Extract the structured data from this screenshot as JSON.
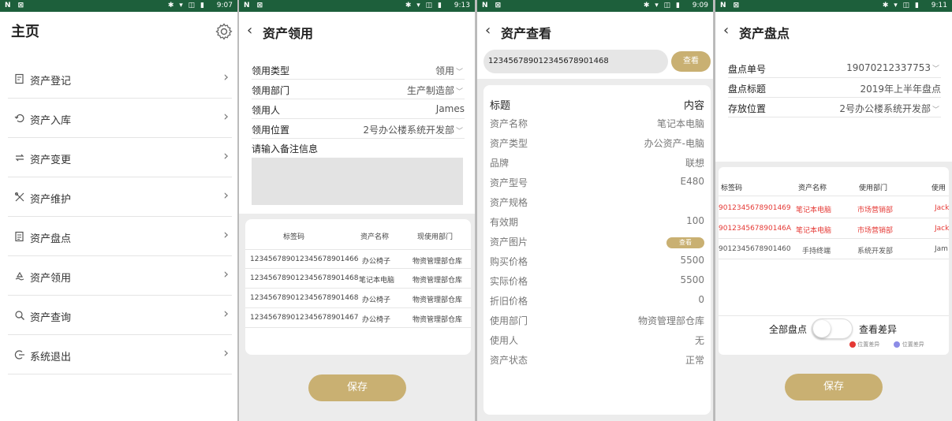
{
  "screens": [
    {
      "time": "9:07",
      "title": "主页",
      "menu": [
        {
          "label": "资产登记",
          "icon": "register-icon"
        },
        {
          "label": "资产入库",
          "icon": "inbound-icon"
        },
        {
          "label": "资产变更",
          "icon": "change-icon"
        },
        {
          "label": "资产维护",
          "icon": "maintain-icon"
        },
        {
          "label": "资产盘点",
          "icon": "inventory-icon"
        },
        {
          "label": "资产领用",
          "icon": "requisition-icon"
        },
        {
          "label": "资产查询",
          "icon": "query-icon"
        },
        {
          "label": "系统退出",
          "icon": "logout-icon"
        }
      ]
    },
    {
      "time": "9:13",
      "title": "资产领用",
      "fields": [
        {
          "label": "领用类型",
          "value": "领用"
        },
        {
          "label": "领用部门",
          "value": "生产制造部"
        },
        {
          "label": "领用人",
          "value": "James"
        },
        {
          "label": "领用位置",
          "value": "2号办公楼系统开发部"
        }
      ],
      "remark_label": "请输入备注信息",
      "table": {
        "headers": [
          "标签码",
          "资产名称",
          "现使用部门"
        ],
        "rows": [
          [
            "123456789012345678901466",
            "办公椅子",
            "物资管理部仓库"
          ],
          [
            "123456789012345678901468",
            "笔记本电脑",
            "物资管理部仓库"
          ],
          [
            "123456789012345678901468",
            "办公椅子",
            "物资管理部仓库"
          ],
          [
            "123456789012345678901467",
            "办公椅子",
            "物资管理部仓库"
          ]
        ]
      },
      "save_label": "保存"
    },
    {
      "time": "9:09",
      "title": "资产查看",
      "search_value": "123456789012345678901468",
      "search_button": "查看",
      "header": {
        "key": "标题",
        "value": "内容"
      },
      "details": [
        {
          "label": "资产名称",
          "value": "笔记本电脑"
        },
        {
          "label": "资产类型",
          "value": "办公资产-电脑"
        },
        {
          "label": "品牌",
          "value": "联想"
        },
        {
          "label": "资产型号",
          "value": "E480"
        },
        {
          "label": "资产规格",
          "value": ""
        },
        {
          "label": "有效期",
          "value": "100"
        },
        {
          "label": "资产图片",
          "value": "查看"
        },
        {
          "label": "购买价格",
          "value": "5500"
        },
        {
          "label": "实际价格",
          "value": "5500"
        },
        {
          "label": "折旧价格",
          "value": "0"
        },
        {
          "label": "使用部门",
          "value": "物资管理部仓库"
        },
        {
          "label": "使用人",
          "value": "无"
        },
        {
          "label": "资产状态",
          "value": "正常"
        }
      ]
    },
    {
      "time": "9:11",
      "title": "资产盘点",
      "fields": [
        {
          "label": "盘点单号",
          "value": "19070212337753"
        },
        {
          "label": "盘点标题",
          "value": "2019年上半年盘点"
        },
        {
          "label": "存放位置",
          "value": "2号办公楼系统开发部"
        }
      ],
      "table": {
        "headers": [
          "标签码",
          "资产名称",
          "使用部门",
          "使用"
        ],
        "rows": [
          {
            "cells": [
              "9012345678901469",
              "笔记本电脑",
              "市场营销部",
              "Jack"
            ],
            "color": "#e53935"
          },
          {
            "cells": [
              "901234567890146A",
              "笔记本电脑",
              "市场营销部",
              "Jack"
            ],
            "color": "#e53935"
          },
          {
            "cells": [
              "9012345678901460",
              "手持终端",
              "系统开发部",
              "Jam"
            ],
            "color": "#555555"
          }
        ]
      },
      "toggle_label": "全部盘点",
      "diff_label": "查看差异",
      "legend": [
        {
          "label": "位置差异",
          "color": "#e53935"
        },
        {
          "label": "位置差异",
          "color": "#8c8ce6"
        }
      ],
      "save_label": "保存"
    }
  ],
  "colors": {
    "status_bar": "#1d5f3b",
    "accent": "#c9b072",
    "diff_red": "#e53935"
  }
}
